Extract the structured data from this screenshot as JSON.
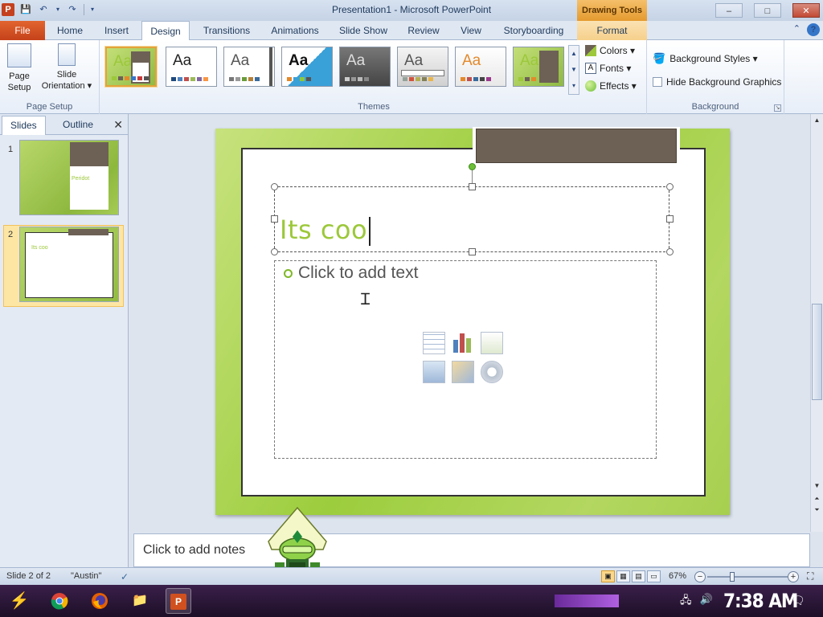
{
  "window": {
    "app_icon_letter": "P",
    "title": "Presentation1 - Microsoft PowerPoint",
    "contextual_group": "Drawing Tools",
    "minimize": "–",
    "maximize": "□",
    "close": "✕"
  },
  "quick_access": {
    "save_icon": "save-icon",
    "undo_icon": "undo-icon",
    "redo_icon": "redo-icon"
  },
  "tabs": {
    "file": "File",
    "home": "Home",
    "insert": "Insert",
    "design": "Design",
    "transitions": "Transitions",
    "animations": "Animations",
    "slide_show": "Slide Show",
    "review": "Review",
    "view": "View",
    "storyboarding": "Storyboarding",
    "format": "Format",
    "help": "?"
  },
  "ribbon": {
    "page_setup_group": "Page Setup",
    "page_setup_btn_1": "Page",
    "page_setup_btn_2": "Setup",
    "orientation_btn_1": "Slide",
    "orientation_btn_2": "Orientation ▾",
    "themes_group": "Themes",
    "theme_sample": "Aa",
    "colors": "Colors ▾",
    "fonts": "Fonts ▾",
    "effects": "Effects ▾",
    "background_group": "Background",
    "background_styles": "Background Styles ▾",
    "hide_bg_graphics": "Hide Background Graphics"
  },
  "themes": [
    {
      "aa_color": "#9cc83a",
      "selected": true
    },
    {
      "aa_color": "#222222",
      "selected": false
    },
    {
      "aa_color": "#555555",
      "selected": false
    },
    {
      "aa_color": "#111111",
      "selected": false
    },
    {
      "aa_color": "#dddddd",
      "selected": false
    },
    {
      "aa_color": "#555555",
      "selected": false
    },
    {
      "aa_color": "#e3892c",
      "selected": false
    },
    {
      "aa_color": "#9cc83a",
      "selected": false
    }
  ],
  "slides_panel": {
    "tab_slides": "Slides",
    "tab_outline": "Outline",
    "close": "✕",
    "slide1_num": "1",
    "slide2_num": "2",
    "slide1_caption": "Peridot",
    "slide2_caption": "Its coo"
  },
  "slide": {
    "title_text": "Its coo",
    "body_placeholder": "Click to add text"
  },
  "notes": {
    "placeholder": "Click to add notes"
  },
  "status": {
    "slide_info": "Slide 2 of 2",
    "theme_name": "\"Austin\"",
    "zoom": "67%",
    "zoom_minus": "−",
    "zoom_plus": "+"
  },
  "taskbar": {
    "clock": "7:38 AM"
  },
  "colors": {
    "accent_green": "#9cc83a",
    "brown_block": "#6d6156",
    "file_tab": "#d0501f"
  }
}
